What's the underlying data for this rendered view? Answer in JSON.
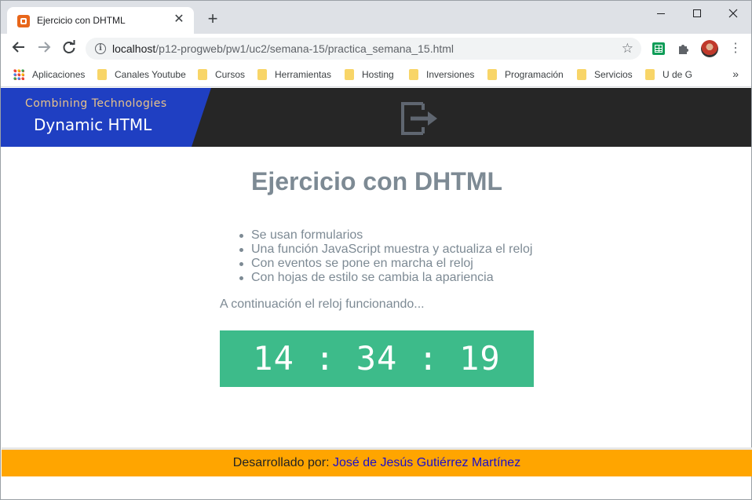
{
  "browser": {
    "tab_title": "Ejercicio con DHTML",
    "tab_close": "✕",
    "new_tab": "+",
    "url_host": "localhost",
    "url_path": "/p12-progweb/pw1/uc2/semana-15/practica_semana_15.html",
    "bookmarks": [
      {
        "label": "Aplicaciones",
        "icon": "apps-grid-icon"
      },
      {
        "label": "Canales Youtube",
        "icon": "folder-icon"
      },
      {
        "label": "Cursos",
        "icon": "folder-icon"
      },
      {
        "label": "Herramientas",
        "icon": "folder-icon"
      },
      {
        "label": "Hosting",
        "icon": "folder-icon"
      },
      {
        "label": "Inversiones",
        "icon": "folder-icon"
      },
      {
        "label": "Programación",
        "icon": "folder-icon"
      },
      {
        "label": "Servicios",
        "icon": "folder-icon"
      },
      {
        "label": "U de G",
        "icon": "folder-icon"
      }
    ],
    "bookmarks_more": "»"
  },
  "banner": {
    "subtitle": "Combining Technologies",
    "title": "Dynamic HTML",
    "brand_blue": "#1f3fc2",
    "dark_bg": "#262626"
  },
  "main": {
    "title": "Ejercicio con DHTML",
    "features": [
      "Se usan formularios",
      "Una función JavaScript muestra y actualiza el reloj",
      "Con eventos se pone en marcha el reloj",
      "Con hojas de estilo se cambia la apariencia"
    ],
    "intro": "A continuación el reloj funcionando...",
    "clock": "14 : 34 : 19",
    "clock_color": "#3dbb8a"
  },
  "footer": {
    "prefix": "Desarrollado por:",
    "author": "José de Jesús Gutiérrez Martínez",
    "bg_color": "#ffa500"
  }
}
